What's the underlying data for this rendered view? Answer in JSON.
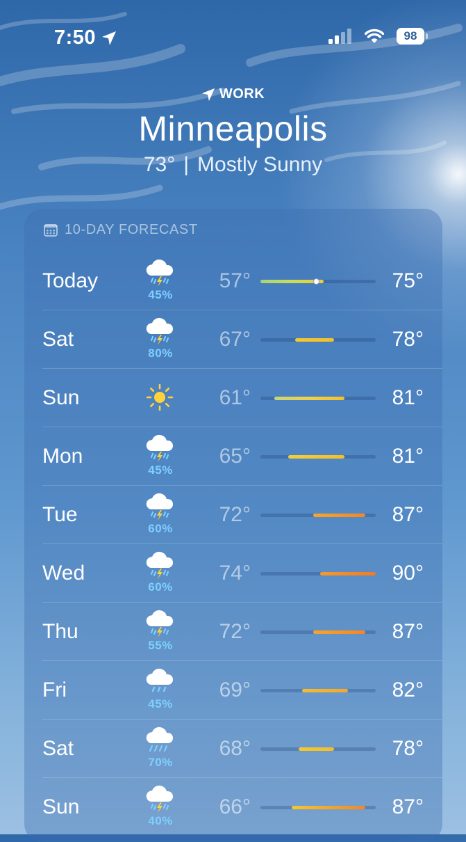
{
  "status_bar": {
    "time": "7:50",
    "battery": "98"
  },
  "header": {
    "location_label": "WORK",
    "city": "Minneapolis",
    "current_temp": "73°",
    "separator": "|",
    "condition": "Mostly Sunny"
  },
  "forecast": {
    "title": "10-DAY FORECAST",
    "range_min": 57,
    "range_max": 90,
    "current_temp_value": 73,
    "days": [
      {
        "day": "Today",
        "icon": "thunderstorm-icon",
        "pop": "45%",
        "low": "57°",
        "high": "75°",
        "low_value": 57,
        "high_value": 75,
        "colors": [
          "#a7d57a",
          "#c9dc58",
          "#f2cd32"
        ]
      },
      {
        "day": "Sat",
        "icon": "thunderstorm-icon",
        "pop": "80%",
        "low": "67°",
        "high": "78°",
        "low_value": 67,
        "high_value": 78,
        "colors": [
          "#f2c82f",
          "#f3c02d"
        ]
      },
      {
        "day": "Sun",
        "icon": "sun-icon",
        "pop": "",
        "low": "61°",
        "high": "81°",
        "low_value": 61,
        "high_value": 81,
        "colors": [
          "#c6d77a",
          "#efd04a",
          "#f4c02c"
        ]
      },
      {
        "day": "Mon",
        "icon": "thunderstorm-icon",
        "pop": "45%",
        "low": "65°",
        "high": "81°",
        "low_value": 65,
        "high_value": 81,
        "colors": [
          "#f0d03a",
          "#f4bd2b"
        ]
      },
      {
        "day": "Tue",
        "icon": "thunderstorm-icon",
        "pop": "60%",
        "low": "72°",
        "high": "87°",
        "low_value": 72,
        "high_value": 87,
        "colors": [
          "#f5a52d",
          "#f2862a"
        ]
      },
      {
        "day": "Wed",
        "icon": "thunderstorm-icon",
        "pop": "60%",
        "low": "74°",
        "high": "90°",
        "low_value": 74,
        "high_value": 90,
        "colors": [
          "#f49a2c",
          "#ef7a2a"
        ]
      },
      {
        "day": "Thu",
        "icon": "thunderstorm-icon",
        "pop": "55%",
        "low": "72°",
        "high": "87°",
        "low_value": 72,
        "high_value": 87,
        "colors": [
          "#f5a52d",
          "#f2862a"
        ]
      },
      {
        "day": "Fri",
        "icon": "rain-icon",
        "pop": "45%",
        "low": "69°",
        "high": "82°",
        "low_value": 69,
        "high_value": 82,
        "colors": [
          "#f3bd2e",
          "#f4a72c"
        ]
      },
      {
        "day": "Sat",
        "icon": "heavy-rain-icon",
        "pop": "70%",
        "low": "68°",
        "high": "78°",
        "low_value": 68,
        "high_value": 78,
        "colors": [
          "#f3c92f",
          "#f3bd2d"
        ]
      },
      {
        "day": "Sun",
        "icon": "thunderstorm-icon",
        "pop": "40%",
        "low": "66°",
        "high": "87°",
        "low_value": 66,
        "high_value": 87,
        "colors": [
          "#f3c72f",
          "#f2862a"
        ]
      }
    ]
  }
}
